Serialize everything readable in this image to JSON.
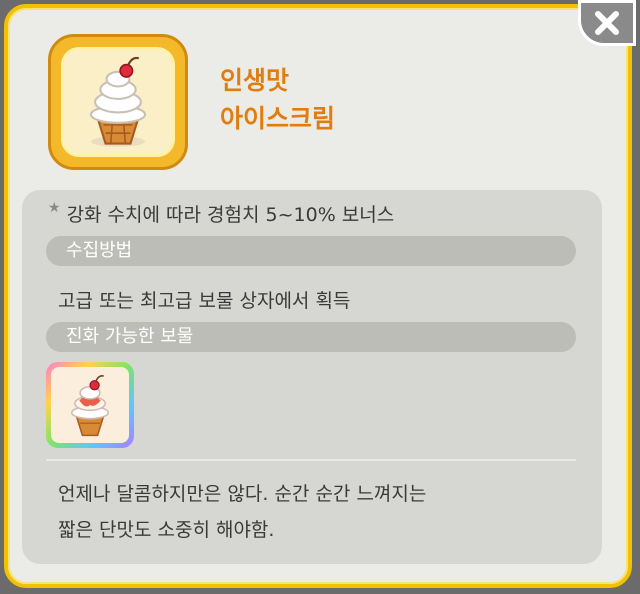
{
  "item": {
    "name_line1": "인생맛",
    "name_line2": "아이스크림",
    "icon": "soft-serve-ice-cream-icon"
  },
  "bonus_text": "강화 수치에 따라 경험치 5~10% 보너스",
  "sections": {
    "collect_header": "수집방법",
    "collect_text": "고급 또는 최고급 보물 상자에서 획득",
    "evolve_header": "진화 가능한 보물"
  },
  "description_line1": "언제나 달콤하지만은 않다. 순간 순간 느껴지는",
  "description_line2": "짧은 단맛도 소중히 해야함.",
  "close_icon": "close-icon",
  "colors": {
    "frame_border": "#f2c100",
    "title_orange": "#e07d0e",
    "header_gray": "#bdbdb8"
  }
}
